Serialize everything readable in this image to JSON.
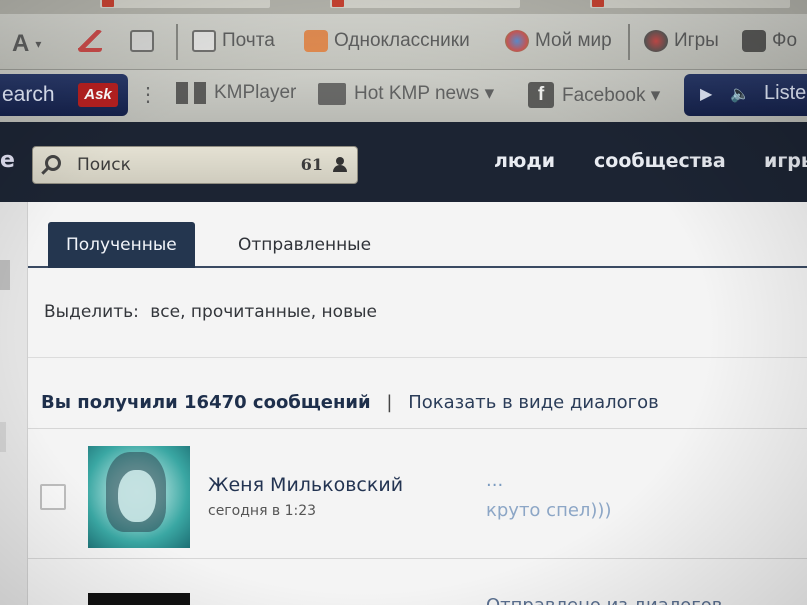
{
  "browser": {
    "toolbar1": {
      "font_button": "A",
      "items": [
        {
          "label": "Почта",
          "icon": "mail-icon"
        },
        {
          "label": "Одноклассники",
          "icon": "odnoklassniki-icon"
        },
        {
          "label": "Мой мир",
          "icon": "my-world-icon"
        },
        {
          "label": "Игры",
          "icon": "games-icon"
        },
        {
          "label": "Фо",
          "icon": "photo-icon"
        }
      ]
    },
    "toolbar2": {
      "search_label": "earch",
      "ask_logo": "Ask",
      "items": [
        {
          "label": "KMPlayer",
          "icon": "kmplayer-icon"
        },
        {
          "label": "Hot KMP news ▾",
          "icon": "rss-icon"
        },
        {
          "label": "Facebook ▾",
          "icon": "facebook-icon"
        }
      ],
      "player_label": "Liste"
    }
  },
  "vk_header": {
    "search_placeholder": "Поиск",
    "online_count": "61",
    "nav": [
      "люди",
      "сообщества",
      "игры"
    ]
  },
  "messages": {
    "tabs": [
      {
        "label": "Полученные",
        "active": true
      },
      {
        "label": "Отправленные",
        "active": false
      }
    ],
    "select_label": "Выделить:",
    "select_options": "все, прочитанные, новые",
    "summary": {
      "count_text": "Вы получили 16470 сообщений",
      "separator": "|",
      "dialogs_link": "Показать в виде диалогов"
    },
    "rows": [
      {
        "sender": "Женя Мильковский",
        "time": "сегодня в 1:23",
        "title": "...",
        "preview": "круто спел)))"
      }
    ],
    "partial_row_note": "Отправлено из диалогов"
  },
  "colors": {
    "vk_header_bg": "#1c2433",
    "active_tab_bg": "#24364f",
    "link_color": "#2b3d59",
    "preview_color": "#8ca6c6"
  }
}
